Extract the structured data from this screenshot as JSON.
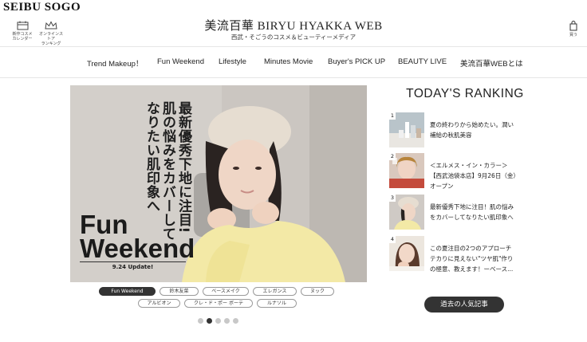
{
  "header": {
    "brand": "SEIBU SOGO",
    "link_calendar": "新作コスメ\nカレンダー",
    "link_ranking": "オンラインストア\nランキング",
    "site_title": "美流百華 BIRYU HYAKKA WEB",
    "site_subtitle": "西武・そごうのコスメ＆ビューティーメディア",
    "cart_label": "買う"
  },
  "nav": [
    "Trend Makeup！",
    "Fun Weekend",
    "Lifestyle",
    "Minutes Movie",
    "Buyer's PICK UP",
    "BEAUTY LIVE",
    "美流百華WEBとは"
  ],
  "hero": {
    "title_line1": "Fun",
    "title_line2": "Weekend",
    "update": "9.24 Update!",
    "headline_col1": "最新優秀下地に注目!",
    "headline_col2": "肌の悩みをカバーして",
    "headline_col3": "なりたい肌印象へ"
  },
  "tags": {
    "row1": [
      "Fun Weekend",
      "鈴木友菜",
      "ベースメイク",
      "エレガンス",
      "ヌック"
    ],
    "row2": [
      "アルビオン",
      "クレ・ド・ポー ボーテ",
      "ルナソル"
    ],
    "active": "Fun Weekend"
  },
  "carousel": {
    "count": 5,
    "active_index": 1
  },
  "ranking": {
    "title": "TODAY'S RANKING",
    "items": [
      {
        "rank": "1",
        "text": "夏の終わりから始めたい。潤い補給の秋肌美容"
      },
      {
        "rank": "2",
        "text": "＜エルメス・イン・カラー＞【西武池袋本店】9月26日（金）オープン"
      },
      {
        "rank": "3",
        "text": "最新優秀下地に注目！肌の悩みをカバーしてなりたい肌印象へ"
      },
      {
        "rank": "4",
        "text": "この夏注目の2つのアプローチ テカりに見えない\"ツヤ肌\"作りの極意、教えます！ーベース..."
      }
    ],
    "past_button": "過去の人気記事"
  },
  "colors": {
    "dark": "#333333",
    "hero_sweater": "#f3e9a6",
    "hero_bg": "#cfc9c4"
  }
}
